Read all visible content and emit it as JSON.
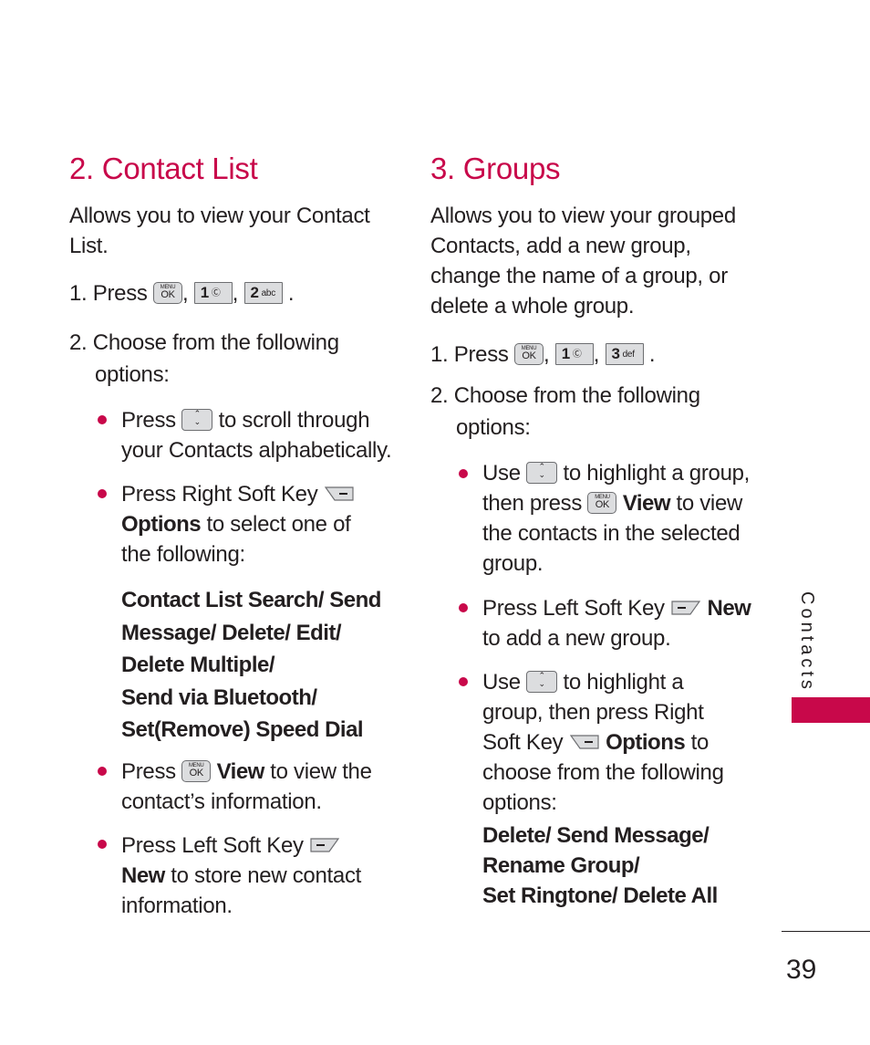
{
  "left": {
    "title": "2. Contact List",
    "intro": "Allows you to view your Contact List.",
    "step1_prefix": "1. Press",
    "step1_keys": [
      {
        "type": "menu-ok",
        "top": "MENU",
        "label": "OK"
      },
      {
        "type": "num",
        "label": "1",
        "sub": "voicemail"
      },
      {
        "type": "num",
        "label": "2",
        "sub": "abc"
      }
    ],
    "step2": "2. Choose from the following options:",
    "bullets": [
      {
        "pre": "Press",
        "icon": "nav-up-down",
        "post": "to scroll through your Contacts alphabetically."
      },
      {
        "pre": "Press Right Soft Key",
        "icon": "right-soft-key",
        "bold": "Options",
        "post": "to select one of the following:"
      },
      {
        "pre": "Press",
        "icon": "menu-ok",
        "bold": "View",
        "post": "to view the contact's information."
      },
      {
        "pre": "Press Left Soft Key",
        "icon": "left-soft-key",
        "bold": "New",
        "post": "to store new contact information."
      }
    ],
    "options_list": [
      "Contact List Search/ Send",
      "Message/ Delete/ Edit/",
      "Delete Multiple/",
      "Send via Bluetooth/",
      "Set(Remove) Speed Dial"
    ]
  },
  "right": {
    "title": "3. Groups",
    "intro": [
      "Allows you to view your grouped",
      "Contacts, add a new group,",
      "change the name of a group, or",
      "delete a whole group."
    ],
    "step1_prefix": "1. Press",
    "step1_keys": [
      {
        "type": "menu-ok",
        "top": "MENU",
        "label": "OK"
      },
      {
        "type": "num",
        "label": "1",
        "sub": "voicemail"
      },
      {
        "type": "num",
        "label": "3",
        "sub": "def"
      }
    ],
    "step2": "2. Choose from the following options:",
    "bullets": [
      {
        "pre": "Use",
        "icon": "nav-up-down",
        "post1": "to highlight a",
        "post2": "group, then press",
        "bold": "View",
        "post3": "to view the contacts in the selected group."
      },
      {
        "pre": "Press Left Soft Key",
        "icon": "left-soft-key",
        "bold": "New",
        "post": "to add a new group."
      },
      {
        "pre": "Use",
        "icon": "nav-up-down",
        "post1": "to highlight a",
        "post2": "group, then press Right",
        "post3": "Soft Key",
        "bold": "Options",
        "post4": "to",
        "post5": "choose from the following",
        "post6": "options:"
      }
    ],
    "options_list": [
      "Delete/ Send Message/",
      "Rename Group/",
      "Set Ringtone/ Delete All"
    ]
  },
  "side_tab": "Contacts",
  "page_number": "39",
  "accent_color": "#c8084a"
}
